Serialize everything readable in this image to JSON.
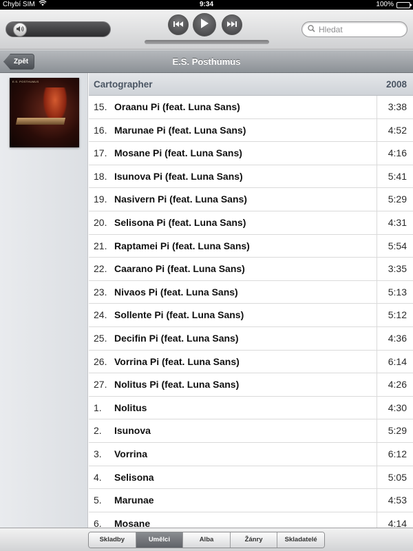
{
  "status_bar": {
    "carrier": "Chybí SIM",
    "time": "9:34",
    "battery": "100%",
    "battery_level": 1.0
  },
  "player": {
    "volume_level": 0.08,
    "search": {
      "placeholder": "Hledat",
      "value": ""
    },
    "icons": {
      "volume": "speaker-icon",
      "previous": "previous-track-icon",
      "play": "play-icon",
      "next": "next-track-icon",
      "search": "magnifier-icon"
    }
  },
  "nav": {
    "back_label": "Zpět",
    "title": "E.S. Posthumus"
  },
  "artwork": {
    "text": "E.S. POSTHUMUS"
  },
  "album": {
    "name": "Cartographer",
    "year": "2008",
    "tracks": [
      {
        "number": "15.",
        "title": "Oraanu Pi (feat. Luna Sans)",
        "duration": "3:38"
      },
      {
        "number": "16.",
        "title": "Marunae Pi (feat. Luna Sans)",
        "duration": "4:52"
      },
      {
        "number": "17.",
        "title": "Mosane Pi (feat. Luna Sans)",
        "duration": "4:16"
      },
      {
        "number": "18.",
        "title": "Isunova Pi (feat. Luna Sans)",
        "duration": "5:41"
      },
      {
        "number": "19.",
        "title": "Nasivern Pi (feat. Luna Sans)",
        "duration": "5:29"
      },
      {
        "number": "20.",
        "title": "Selisona Pi (feat. Luna Sans)",
        "duration": "4:31"
      },
      {
        "number": "21.",
        "title": "Raptamei Pi (feat. Luna Sans)",
        "duration": "5:54"
      },
      {
        "number": "22.",
        "title": "Caarano Pi (feat. Luna Sans)",
        "duration": "3:35"
      },
      {
        "number": "23.",
        "title": "Nivaos Pi (feat. Luna Sans)",
        "duration": "5:13"
      },
      {
        "number": "24.",
        "title": "Sollente Pi (feat. Luna Sans)",
        "duration": "5:12"
      },
      {
        "number": "25.",
        "title": "Decifin Pi (feat. Luna Sans)",
        "duration": "4:36"
      },
      {
        "number": "26.",
        "title": "Vorrina Pi (feat. Luna Sans)",
        "duration": "6:14"
      },
      {
        "number": "27.",
        "title": "Nolitus Pi (feat. Luna Sans)",
        "duration": "4:26"
      },
      {
        "number": "1.",
        "title": "Nolitus",
        "duration": "4:30"
      },
      {
        "number": "2.",
        "title": "Isunova",
        "duration": "5:29"
      },
      {
        "number": "3.",
        "title": "Vorrina",
        "duration": "6:12"
      },
      {
        "number": "4.",
        "title": "Selisona",
        "duration": "5:05"
      },
      {
        "number": "5.",
        "title": "Marunae",
        "duration": "4:53"
      },
      {
        "number": "6.",
        "title": "Mosane",
        "duration": "4:14"
      }
    ]
  },
  "tabs": {
    "items": [
      "Skladby",
      "Umělci",
      "Alba",
      "Žánry",
      "Skladatelé"
    ],
    "active": "Umělci"
  }
}
